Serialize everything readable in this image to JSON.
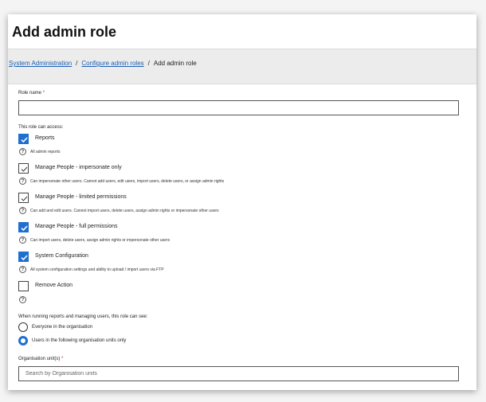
{
  "page": {
    "title": "Add admin role"
  },
  "breadcrumb": {
    "items": [
      {
        "label": "System Administration"
      },
      {
        "label": "Configure admin roles"
      },
      {
        "label": "Add admin role"
      }
    ],
    "separator": "/"
  },
  "form": {
    "role_name": {
      "label": "Role name",
      "required_mark": "*",
      "value": ""
    },
    "access_heading": "This role can access:",
    "permissions": [
      {
        "label": "Reports",
        "checked": true,
        "help": "All admin reports"
      },
      {
        "label": "Manage People - impersonate only",
        "checked": false,
        "help": "Can impersonate other users. Cannot add users, edit users, import users, delete users, or assign admin rights"
      },
      {
        "label": "Manage People - limited permissions",
        "checked": false,
        "help": "Can add and edit users. Cannot import users, delete users, assign admin rights or impersonate other users"
      },
      {
        "label": "Manage People - full permissions",
        "checked": true,
        "help": "Can import users, delete users, assign admin rights or impersonate other users"
      },
      {
        "label": "System Configuration",
        "checked": true,
        "help": "All system configuration settings and ability to upload / import users via FTP"
      },
      {
        "label": "Remove Action",
        "checked": false,
        "help": ""
      }
    ],
    "visibility_heading": "When running reports and managing users, this role can see:",
    "visibility_options": [
      {
        "label": "Everyone in the organisation",
        "selected": false
      },
      {
        "label": "Users in the following organisation units only",
        "selected": true
      }
    ],
    "org_units": {
      "label": "Organisation unit(s)",
      "required_mark": "*",
      "placeholder": "Search by Organisation units",
      "value": ""
    },
    "help_glyph": "?"
  },
  "colors": {
    "accent": "#1f6fd1",
    "link": "#1a5fb4",
    "required": "#c62828"
  }
}
